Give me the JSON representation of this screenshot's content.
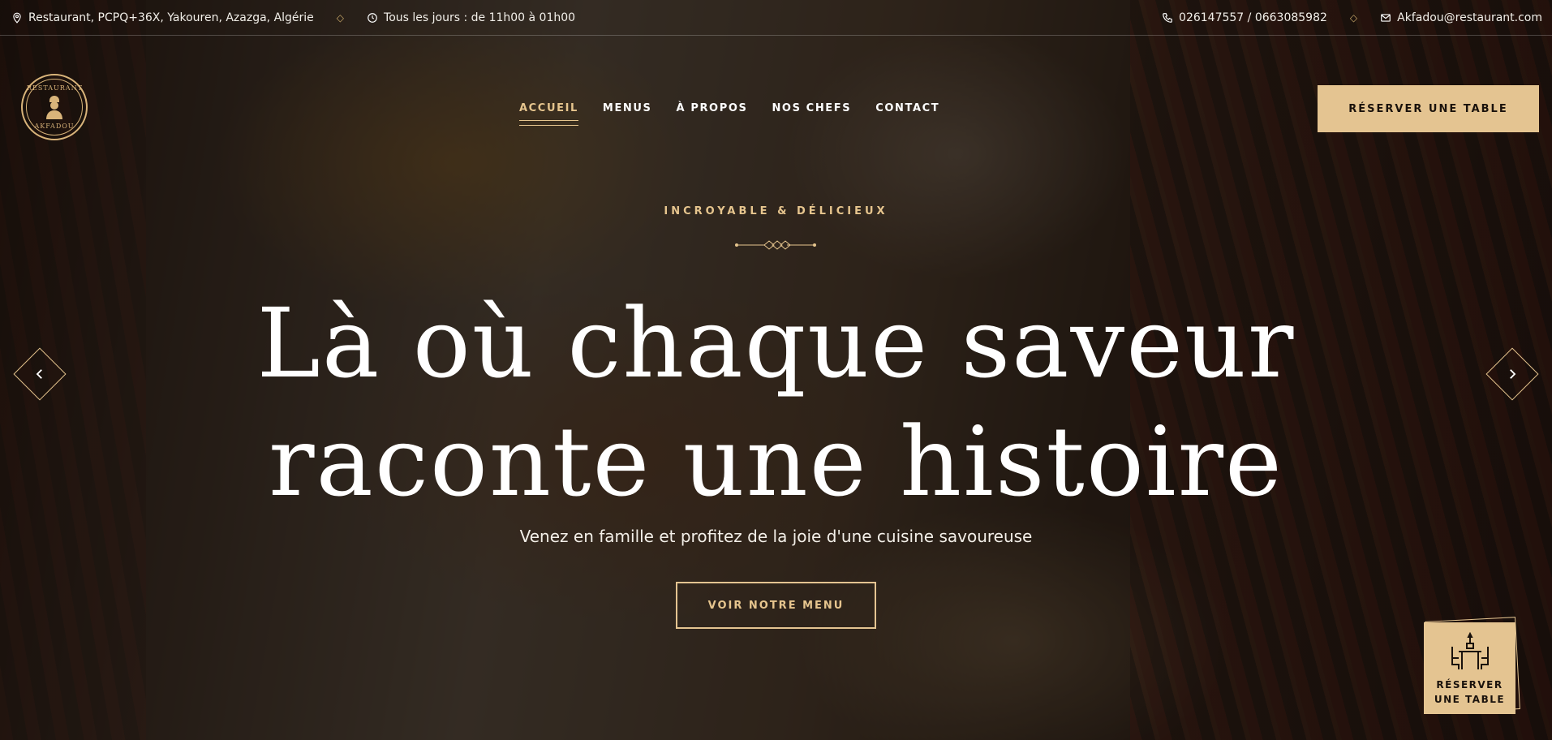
{
  "topbar": {
    "address": "Restaurant, PCPQ+36X, Yakouren, Azazga, Algérie",
    "hours": "Tous les jours : de 11h00 à 01h00",
    "phone": "026147557 / 0663085982",
    "email": "Akfadou@restaurant.com",
    "separator": "◇"
  },
  "logo": {
    "top": "RESTAURANT",
    "bottom": "AKFADOU"
  },
  "nav": {
    "items": [
      {
        "label": "ACCUEIL",
        "active": true
      },
      {
        "label": "MENUS"
      },
      {
        "label": "À PROPOS"
      },
      {
        "label": "NOS CHEFS"
      },
      {
        "label": "CONTACT"
      }
    ],
    "reserve_label": "RÉSERVER UNE TABLE"
  },
  "hero": {
    "kicker": "INCROYABLE & DÉLICIEUX",
    "headline_line1": "Là où chaque saveur",
    "headline_line2": "raconte une histoire",
    "subline": "Venez en famille et profitez de la joie d'une cuisine savoureuse",
    "cta_label": "VOIR NOTRE MENU"
  },
  "floating_reserve": {
    "line1": "RÉSERVER",
    "line2": "UNE TABLE"
  },
  "colors": {
    "accent": "#e4c491",
    "accent_text": "#e6c58e",
    "dark": "#1a120c"
  }
}
